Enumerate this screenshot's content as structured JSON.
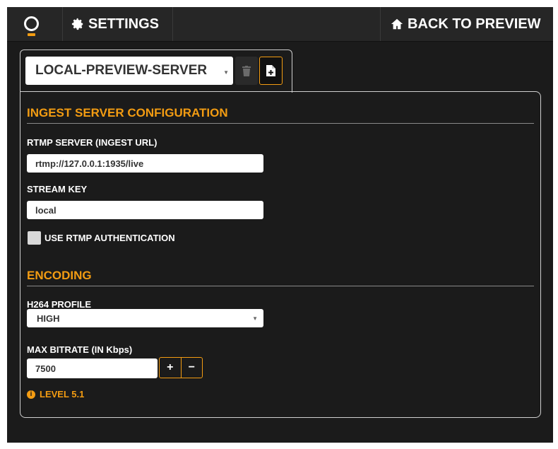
{
  "header": {
    "settings_label": "SETTINGS",
    "back_label": "BACK TO PREVIEW",
    "settings_icon": "gear-icon",
    "back_icon": "home-icon",
    "logo_icon": "ring-logo-icon"
  },
  "server_selector": {
    "selected": "LOCAL-PREVIEW-SERVER",
    "delete_icon": "trash-icon",
    "new_icon": "new-file-icon"
  },
  "ingest": {
    "section_title": "INGEST SERVER CONFIGURATION",
    "rtmp_label": "RTMP SERVER (INGEST URL)",
    "rtmp_value": "rtmp://127.0.0.1:1935/live",
    "stream_key_label": "STREAM KEY",
    "stream_key_value": "local",
    "auth_label": "USE RTMP AUTHENTICATION",
    "auth_checked": false
  },
  "encoding": {
    "section_title": "ENCODING",
    "profile_label": "H264 PROFILE",
    "profile_value": "HIGH",
    "bitrate_label": "MAX BITRATE (IN Kbps)",
    "bitrate_value": "7500",
    "plus": "+",
    "minus": "−",
    "level_text": "LEVEL 5.1",
    "info_icon": "info-icon"
  },
  "colors": {
    "accent": "#f39c12",
    "background": "#1b1b1b",
    "topbar": "#262626"
  }
}
